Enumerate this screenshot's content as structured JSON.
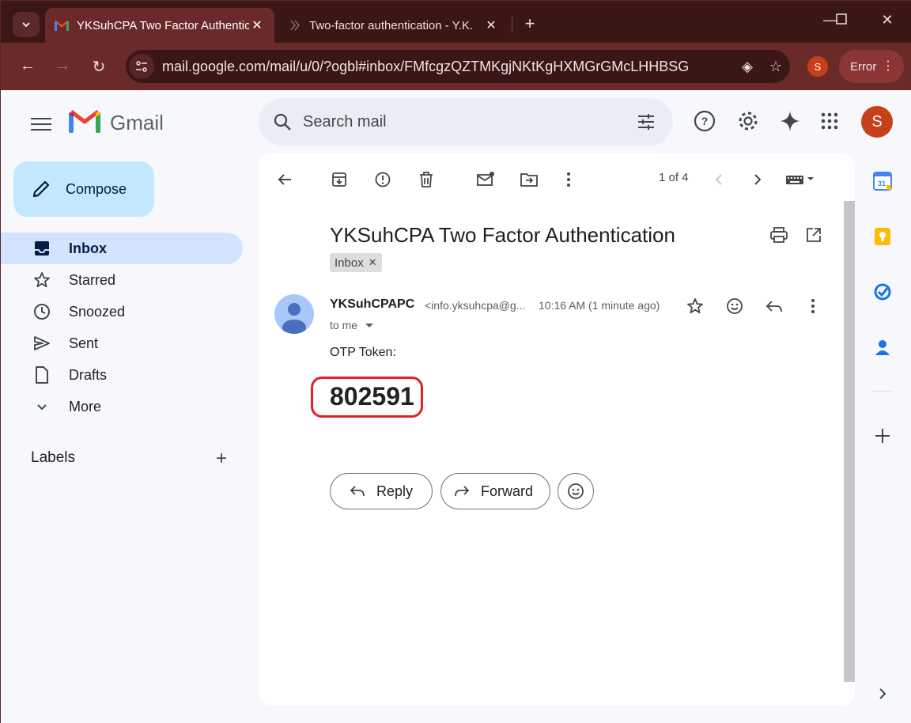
{
  "browser": {
    "tabs": [
      {
        "title": "YKSuhCPA Two Factor Authenticatio",
        "active": true
      },
      {
        "title": "Two-factor authentication - Y.K.",
        "active": false
      }
    ],
    "url": "mail.google.com/mail/u/0/?ogbl#inbox/FMfcgzQZTMKgjNKtKgHXMGrGMcLHHBSG",
    "profile_initial": "S",
    "error_label": "Error"
  },
  "gmail": {
    "app_name": "Gmail",
    "search_placeholder": "Search mail",
    "avatar_initial": "S",
    "compose_label": "Compose",
    "nav": [
      {
        "label": "Inbox",
        "icon": "inbox-icon"
      },
      {
        "label": "Starred",
        "icon": "star-icon"
      },
      {
        "label": "Snoozed",
        "icon": "clock-icon"
      },
      {
        "label": "Sent",
        "icon": "send-icon"
      },
      {
        "label": "Drafts",
        "icon": "draft-icon"
      },
      {
        "label": "More",
        "icon": "chevron-down-icon"
      }
    ],
    "labels_heading": "Labels",
    "pager": "1 of 4",
    "message": {
      "subject": "YKSuhCPA Two Factor Authentication",
      "label_chip": "Inbox",
      "sender_name": "YKSuhCPAPC",
      "sender_email": "<info.yksuhcpa@g...",
      "time": "10:16 AM (1 minute ago)",
      "to": "to me",
      "body_label": "OTP Token:",
      "otp_code": "802591"
    },
    "actions": {
      "reply": "Reply",
      "forward": "Forward"
    }
  },
  "colors": {
    "chrome_dark": "#3b1616",
    "chrome_toolbar": "#6b2a2a",
    "compose_bg": "#c2e7ff",
    "inbox_active": "#d3e3fd",
    "otp_highlight": "#e0202a",
    "avatar": "#c6401a"
  }
}
